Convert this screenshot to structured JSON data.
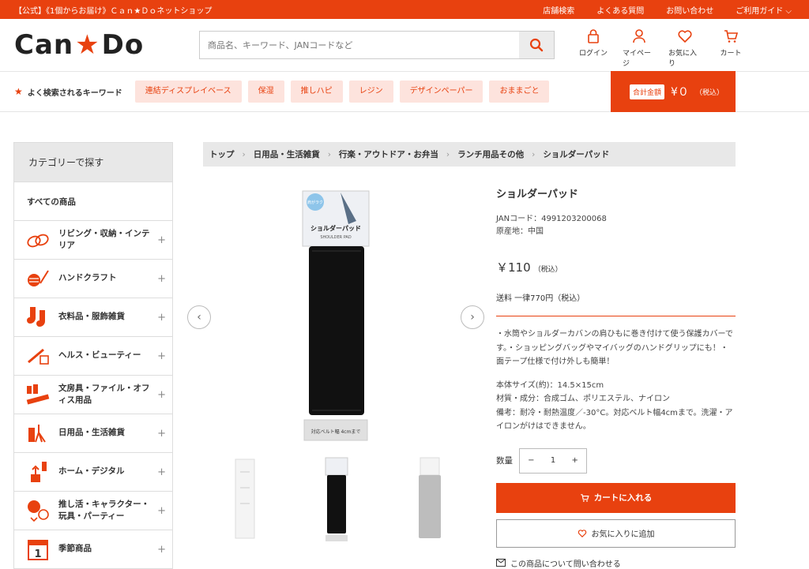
{
  "colors": {
    "accent": "#e8410f",
    "keyword_bg": "#fde3dd"
  },
  "topbar": {
    "left_text": "【公式】《1個からお届け》Ｃａｎ★Ｄｏネットショップ",
    "links": [
      "店舗検索",
      "よくある質問",
      "お問い合わせ",
      "ご利用ガイド"
    ]
  },
  "header": {
    "logo_text_left": "Can",
    "logo_star": "★",
    "logo_text_right": "Do",
    "search_placeholder": "商品名、キーワード、JANコードなど",
    "icons": [
      {
        "label": "ログイン",
        "icon": "lock-icon"
      },
      {
        "label": "マイページ",
        "icon": "user-icon"
      },
      {
        "label": "お気に入り",
        "icon": "heart-icon"
      },
      {
        "label": "カート",
        "icon": "cart-icon"
      }
    ]
  },
  "keywords": {
    "title": "よく検索されるキーワード",
    "items": [
      "連結ディスプレイベース",
      "保湿",
      "推しハピ",
      "レジン",
      "デザインペーパー",
      "おままごと"
    ]
  },
  "cart_total": {
    "label": "合計金額",
    "amount": "¥０",
    "tax": "（税込）"
  },
  "sidebar": {
    "heading": "カテゴリーで探す",
    "all_label": "すべての商品",
    "items": [
      {
        "label": "リビング・収納・インテリア",
        "icon": "living-icon"
      },
      {
        "label": "ハンドクラフト",
        "icon": "craft-icon"
      },
      {
        "label": "衣料品・服飾雑貨",
        "icon": "socks-icon"
      },
      {
        "label": "ヘルス・ビューティー",
        "icon": "beauty-icon"
      },
      {
        "label": "文房具・ファイル・オフィス用品",
        "icon": "stationery-icon"
      },
      {
        "label": "日用品・生活雑貨",
        "icon": "daily-goods-icon"
      },
      {
        "label": "ホーム・デジタル",
        "icon": "home-digital-icon"
      },
      {
        "label": "推し活・キャラクター・玩具・パーティー",
        "icon": "party-icon"
      },
      {
        "label": "季節商品",
        "icon": "calendar-icon"
      }
    ]
  },
  "breadcrumb": [
    "トップ",
    "日用品・生活雑貨",
    "行楽・アウトドア・お弁当",
    "ランチ用品その他",
    "ショルダーパッド"
  ],
  "product": {
    "name": "ショルダーパッド",
    "jan": "JANコード：4991203200068",
    "origin": "原産地：中国",
    "price": "￥110",
    "price_tax": "（税込）",
    "shipping": "送料 一律770円（税込）",
    "description": "・水筒やショルダーカバンの肩ひもに巻き付けて使う保護カバーです。・ショッピングバッグやマイバッグのハンドグリップにも！・面テープ仕様で付け外しも簡単！",
    "spec_size": "本体サイズ(約)：14.5×15cm",
    "spec_material": "材質・成分：合成ゴム、ポリエステル、ナイロン",
    "spec_note": "備考：耐冷・耐熱温度／-30°C。対応ベルト幅4cmまで。洗濯・アイロンがけはできません。",
    "package_title": "ショルダーパッド",
    "package_subtitle": "SHOULDER PAD",
    "package_label": "対応ベルト幅 4cmまで",
    "package_badge": "肩がラク",
    "qty_label": "数量",
    "qty_value": "1",
    "minus": "−",
    "plus": "+",
    "cart_button": "カートに入れる",
    "fav_button": "お気に入りに追加",
    "inquiry": "この商品について問い合わせる"
  }
}
